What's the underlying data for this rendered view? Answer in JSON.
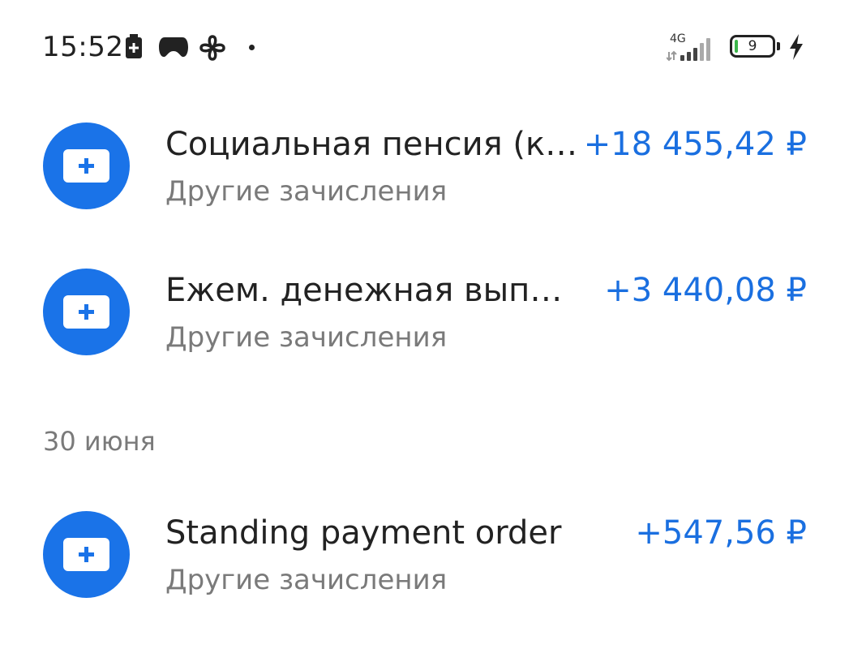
{
  "status_bar": {
    "time": "15:52",
    "network_type": "4G",
    "battery_level": "9",
    "battery_fraction": 0.09,
    "icons": [
      "battery-saver-icon",
      "gamepad-icon",
      "fan-icon",
      "notification-dot-icon",
      "signal-icon",
      "battery-icon",
      "charging-bolt-icon"
    ]
  },
  "colors": {
    "accent": "#1a73e8",
    "amount_positive": "#1a6fe0",
    "secondary_text": "#7a7a7a",
    "battery_fill": "#3bb54a"
  },
  "transactions_group_1": [
    {
      "title": "Социальная пенсия (к…",
      "category": "Другие зачисления",
      "amount": "+18 455,42 ₽",
      "icon": "cash-plus-icon"
    },
    {
      "title": "Ежем. денежная выпл…",
      "category": "Другие зачисления",
      "amount": "+3 440,08 ₽",
      "icon": "cash-plus-icon"
    }
  ],
  "date_header": "30 июня",
  "transactions_group_2": [
    {
      "title": "Standing payment order",
      "category": "Другие зачисления",
      "amount": "+547,56 ₽",
      "icon": "cash-plus-icon"
    }
  ]
}
